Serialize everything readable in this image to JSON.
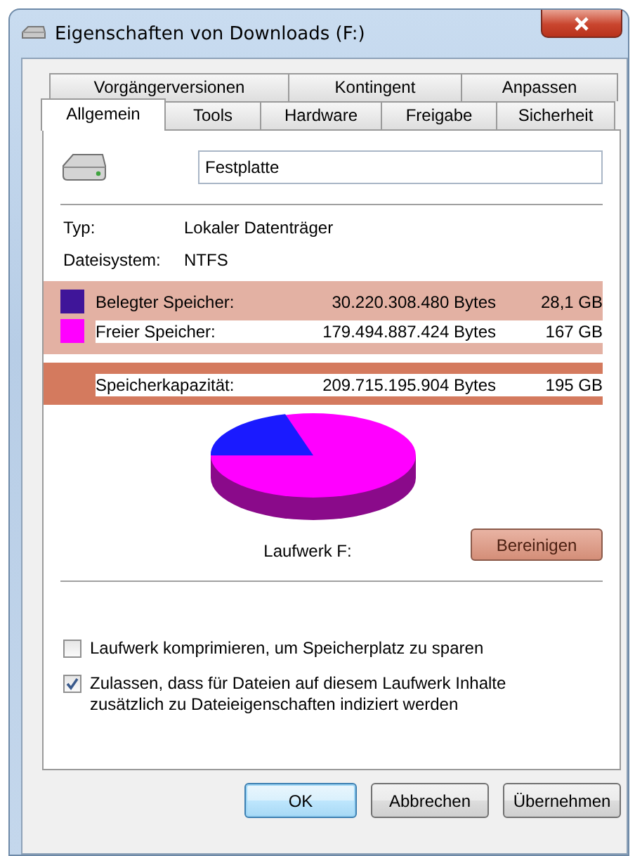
{
  "window": {
    "title": "Eigenschaften von Downloads (F:)"
  },
  "tabs_row_1": [
    {
      "label": "Vorgängerversionen",
      "selected": false
    },
    {
      "label": "Kontingent",
      "selected": false
    },
    {
      "label": "Anpassen",
      "selected": false
    }
  ],
  "tabs_row_2": [
    {
      "label": "Allgemein",
      "selected": true
    },
    {
      "label": "Tools",
      "selected": false
    },
    {
      "label": "Hardware",
      "selected": false
    },
    {
      "label": "Freigabe",
      "selected": false
    },
    {
      "label": "Sicherheit",
      "selected": false
    }
  ],
  "drive_name": {
    "value": "Festplatte"
  },
  "properties": [
    {
      "label": "Typ:",
      "value": "Lokaler Datenträger"
    },
    {
      "label": "Dateisystem:",
      "value": "NTFS"
    }
  ],
  "storage": [
    {
      "label": "Belegter Speicher:",
      "bytes": "30.220.308.480 Bytes",
      "size": "28,1 GB",
      "color": "#3f1599"
    },
    {
      "label": "Freier Speicher:",
      "bytes": "179.494.887.424 Bytes",
      "size": "167 GB",
      "color": "#ff00ff"
    }
  ],
  "capacity": {
    "label": "Speicherkapazität:",
    "bytes": "209.715.195.904 Bytes",
    "size": "195 GB"
  },
  "drive_label": "Laufwerk F:",
  "cleanup_button": "Bereinigen",
  "options": [
    {
      "label": "Laufwerk komprimieren, um Speicherplatz zu sparen",
      "checked": false
    },
    {
      "label": "Zulassen, dass für Dateien auf diesem Laufwerk Inhalte zusätzlich zu Dateieigenschaften indiziert werden",
      "checked": true
    }
  ],
  "buttons": [
    {
      "label": "OK",
      "default": true
    },
    {
      "label": "Abbrechen",
      "default": false
    },
    {
      "label": "Übernehmen",
      "default": false
    }
  ]
}
